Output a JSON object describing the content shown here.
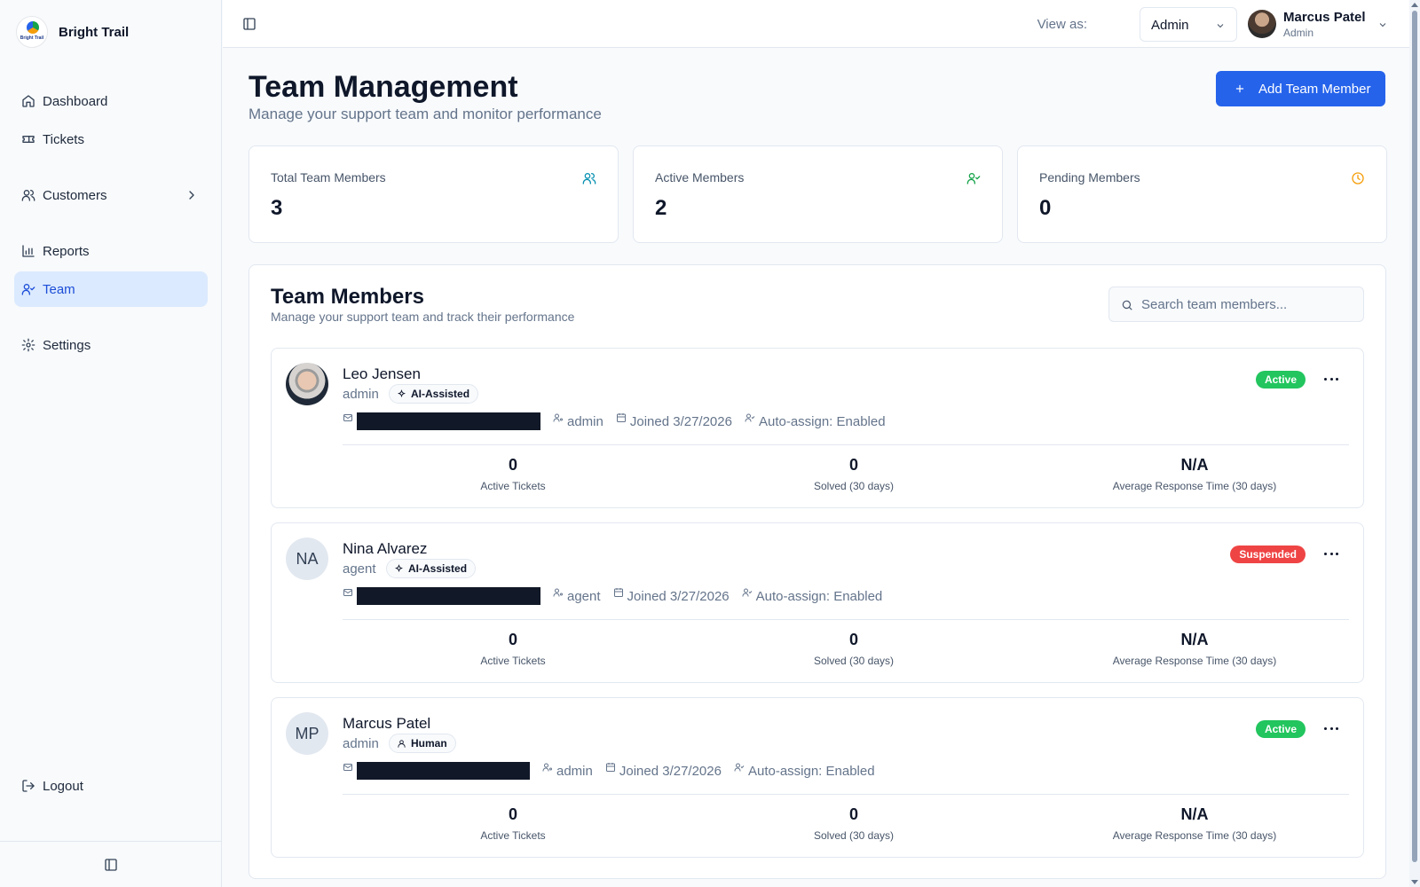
{
  "app": {
    "name": "Bright Trail",
    "logo_text": "Bright Trail"
  },
  "sidebar": {
    "items": [
      {
        "label": "Dashboard",
        "icon": "home-icon"
      },
      {
        "label": "Tickets",
        "icon": "ticket-icon"
      },
      {
        "label": "Customers",
        "icon": "users-icon"
      },
      {
        "label": "Reports",
        "icon": "bar-chart-icon"
      },
      {
        "label": "Team",
        "icon": "user-check-icon",
        "active": true
      },
      {
        "label": "Settings",
        "icon": "gear-icon"
      }
    ],
    "logout_label": "Logout"
  },
  "header": {
    "view_as_label": "View as:",
    "view_as_value": "Admin",
    "user_name": "Marcus Patel",
    "user_role": "Admin"
  },
  "page": {
    "title": "Team Management",
    "subtitle": "Manage your support team and monitor performance",
    "add_button_label": "Add Team Member"
  },
  "stats": [
    {
      "label": "Total Team Members",
      "value": "3",
      "icon": "users-icon",
      "color": "#0891b2"
    },
    {
      "label": "Active Members",
      "value": "2",
      "icon": "user-check-icon",
      "color": "#16a34a"
    },
    {
      "label": "Pending Members",
      "value": "0",
      "icon": "clock-icon",
      "color": "#f59e0b"
    }
  ],
  "members_section": {
    "title": "Team Members",
    "subtitle": "Manage your support team and track their performance",
    "search_placeholder": "Search team members..."
  },
  "members": [
    {
      "name": "Leo Jensen",
      "initials": "",
      "role": "admin",
      "type": "AI-Assisted",
      "status": "Active",
      "meta_role": "admin",
      "joined": "Joined 3/27/2026",
      "auto_assign": "Auto-assign: Enabled",
      "active_tickets": "0",
      "solved": "0",
      "avg_response": "N/A"
    },
    {
      "name": "Nina Alvarez",
      "initials": "NA",
      "role": "agent",
      "type": "AI-Assisted",
      "status": "Suspended",
      "meta_role": "agent",
      "joined": "Joined 3/27/2026",
      "auto_assign": "Auto-assign: Enabled",
      "active_tickets": "0",
      "solved": "0",
      "avg_response": "N/A"
    },
    {
      "name": "Marcus Patel",
      "initials": "MP",
      "role": "admin",
      "type": "Human",
      "status": "Active",
      "meta_role": "admin",
      "joined": "Joined 3/27/2026",
      "auto_assign": "Auto-assign: Enabled",
      "active_tickets": "0",
      "solved": "0",
      "avg_response": "N/A"
    }
  ],
  "stat_labels": {
    "active_tickets": "Active Tickets",
    "solved": "Solved (30 days)",
    "avg_response": "Average Response Time (30 days)"
  },
  "colors": {
    "primary": "#2563eb",
    "active_badge": "#22c55e",
    "suspended_badge": "#ef4444",
    "nav_active_bg": "#dbeafe"
  }
}
